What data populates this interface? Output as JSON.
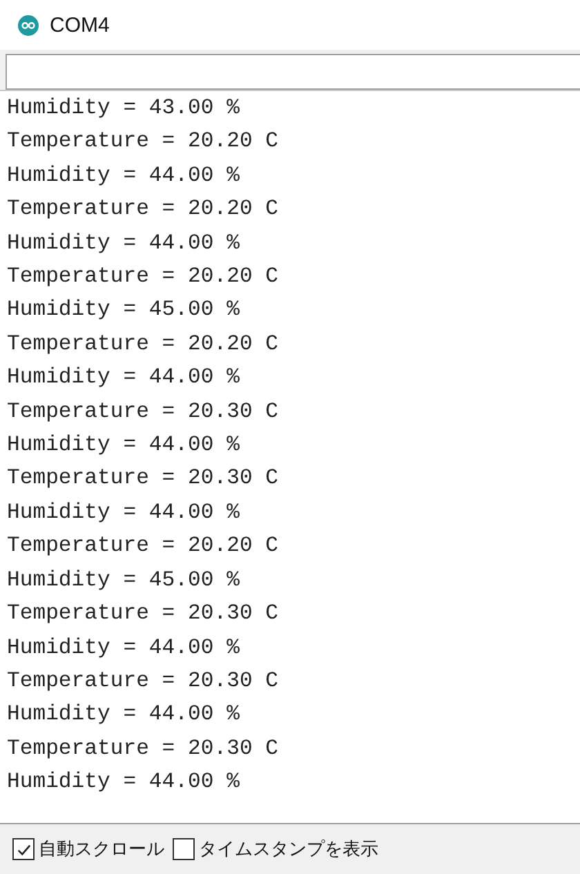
{
  "window": {
    "title": "COM4"
  },
  "output_lines": [
    "Humidity = 43.00 %",
    "Temperature = 20.20 C",
    "Humidity = 44.00 %",
    "Temperature = 20.20 C",
    "Humidity = 44.00 %",
    "Temperature = 20.20 C",
    "Humidity = 45.00 %",
    "Temperature = 20.20 C",
    "Humidity = 44.00 %",
    "Temperature = 20.30 C",
    "Humidity = 44.00 %",
    "Temperature = 20.30 C",
    "Humidity = 44.00 %",
    "Temperature = 20.20 C",
    "Humidity = 45.00 %",
    "Temperature = 20.30 C",
    "Humidity = 44.00 %",
    "Temperature = 20.30 C",
    "Humidity = 44.00 %",
    "Temperature = 20.30 C",
    "Humidity = 44.00 %"
  ],
  "options": [
    {
      "label": "自動スクロール",
      "checked": true
    },
    {
      "label": "タイムスタンプを表示",
      "checked": false
    }
  ]
}
